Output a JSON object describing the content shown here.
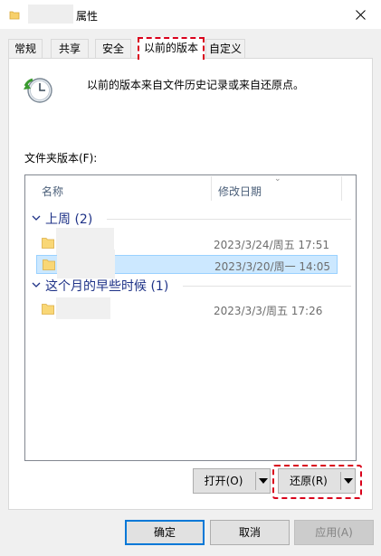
{
  "window": {
    "title": "属性",
    "close_icon": "close-icon",
    "folder_icon": "folder-icon"
  },
  "tabs": [
    {
      "label": "常规",
      "active": false
    },
    {
      "label": "共享",
      "active": false
    },
    {
      "label": "安全",
      "active": false
    },
    {
      "label": "以前的版本",
      "active": true
    },
    {
      "label": "自定义",
      "active": false
    }
  ],
  "panel": {
    "description": "以前的版本来自文件历史记录或来自还原点。",
    "folder_versions_label": "文件夹版本(F):",
    "columns": {
      "name": "名称",
      "date_modified": "修改日期"
    },
    "groups": [
      {
        "label": "上周 (2)",
        "rows": [
          {
            "date": "2023/3/24/周五 17:51",
            "selected": false
          },
          {
            "date": "2023/3/20/周一 14:05",
            "selected": true
          }
        ]
      },
      {
        "label": "这个月的早些时候 (1)",
        "rows": [
          {
            "date": "2023/3/3/周五 17:26",
            "selected": false
          }
        ]
      }
    ],
    "open_button": "打开(O)",
    "restore_button": "还原(R)"
  },
  "footer": {
    "ok": "确定",
    "cancel": "取消",
    "apply": "应用(A)"
  },
  "colors": {
    "highlight": "#d9001b",
    "selection": "#cce8ff",
    "group_text": "#1e3287"
  }
}
